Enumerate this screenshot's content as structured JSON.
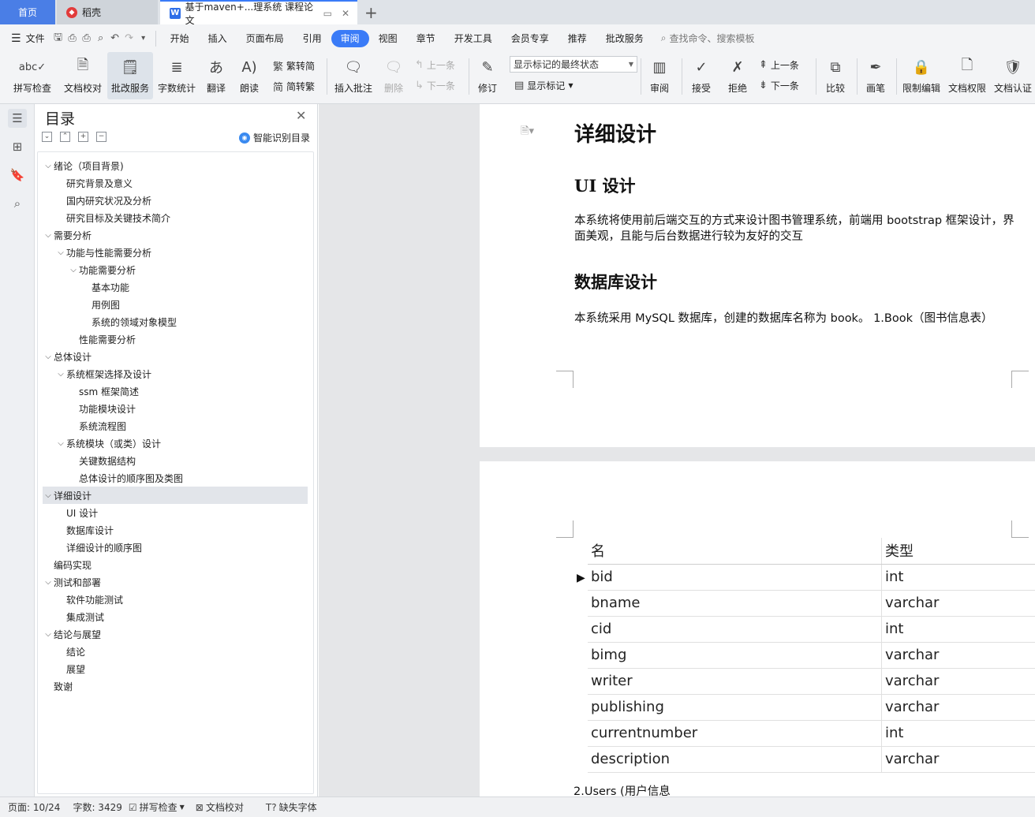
{
  "tabs": {
    "home": "首页",
    "daoke": "稻壳",
    "doc": "基于maven+...理系统 课程论文",
    "add": "+"
  },
  "menu": {
    "file": "文件",
    "items": [
      "开始",
      "插入",
      "页面布局",
      "引用",
      "审阅",
      "视图",
      "章节",
      "开发工具",
      "会员专享",
      "推荐",
      "批改服务"
    ],
    "active": "审阅",
    "search_placeholder": "查找命令、搜索模板"
  },
  "toolbar": {
    "spellcheck": "拼写检查",
    "proofread": "文档校对",
    "grading": "批改服务",
    "wordcount": "字数统计",
    "translate": "翻译",
    "read_aloud": "朗读",
    "trad": "繁转简",
    "simp": "简转繁",
    "insert_comment": "插入批注",
    "delete": "删除",
    "prev_comment": "上一条",
    "next_comment": "下一条",
    "track_changes": "修订",
    "markup_state": "显示标记的最终状态",
    "show_markup": "显示标记",
    "review": "审阅",
    "accept": "接受",
    "reject": "拒绝",
    "prev_change": "上一条",
    "next_change": "下一条",
    "compare": "比较",
    "pen": "画笔",
    "restrict_edit": "限制编辑",
    "doc_permission": "文档权限",
    "doc_cert": "文档认证"
  },
  "toc": {
    "title": "目录",
    "smart": "智能识别目录",
    "items": [
      {
        "text": "绪论（项目背景)",
        "level": 1,
        "caret": true
      },
      {
        "text": "研究背景及意义",
        "level": 2,
        "caret": false
      },
      {
        "text": "国内研究状况及分析",
        "level": 2,
        "caret": false
      },
      {
        "text": "研究目标及关键技术简介",
        "level": 2,
        "caret": false
      },
      {
        "text": "需要分析",
        "level": 1,
        "caret": true
      },
      {
        "text": "功能与性能需要分析",
        "level": 2,
        "caret": true
      },
      {
        "text": "功能需要分析",
        "level": 3,
        "caret": true
      },
      {
        "text": "基本功能",
        "level": 4,
        "caret": false
      },
      {
        "text": "用例图",
        "level": 4,
        "caret": false
      },
      {
        "text": "系统的领域对象模型",
        "level": 4,
        "caret": false
      },
      {
        "text": "性能需要分析",
        "level": 3,
        "caret": false
      },
      {
        "text": "总体设计",
        "level": 1,
        "caret": true
      },
      {
        "text": "系统框架选择及设计",
        "level": 2,
        "caret": true
      },
      {
        "text": "ssm 框架简述",
        "level": 3,
        "caret": false
      },
      {
        "text": "功能模块设计",
        "level": 3,
        "caret": false
      },
      {
        "text": "系统流程图",
        "level": 3,
        "caret": false
      },
      {
        "text": "系统模块（或类）设计",
        "level": 2,
        "caret": true
      },
      {
        "text": "关键数据结构",
        "level": 3,
        "caret": false
      },
      {
        "text": "总体设计的顺序图及类图",
        "level": 3,
        "caret": false
      },
      {
        "text": "详细设计",
        "level": 1,
        "caret": true,
        "selected": true
      },
      {
        "text": "UI 设计",
        "level": 2,
        "caret": false
      },
      {
        "text": "数据库设计",
        "level": 2,
        "caret": false
      },
      {
        "text": "详细设计的顺序图",
        "level": 2,
        "caret": false
      },
      {
        "text": "编码实现",
        "level": 1,
        "caret": false
      },
      {
        "text": "测试和部署",
        "level": 1,
        "caret": true
      },
      {
        "text": "软件功能测试",
        "level": 2,
        "caret": false
      },
      {
        "text": "集成测试",
        "level": 2,
        "caret": false
      },
      {
        "text": "结论与展望",
        "level": 1,
        "caret": true
      },
      {
        "text": "结论",
        "level": 2,
        "caret": false
      },
      {
        "text": "展望",
        "level": 2,
        "caret": false
      },
      {
        "text": "致谢",
        "level": 1,
        "caret": false
      }
    ]
  },
  "document": {
    "h_detail": "详细设计",
    "h_ui": "UI  设计",
    "p_ui": "本系统将使用前后端交互的方式来设计图书管理系统，前端用  bootstrap  框架设计，界面美观，且能与后台数据进行较为友好的交互",
    "h_db": "数据库设计",
    "p_db": "本系统采用  MySQL  数据库，创建的数据库名称为  book。 1.Book（图书信息表）",
    "table_headers": [
      "名",
      "类型"
    ],
    "table_rows": [
      [
        "bid",
        "int"
      ],
      [
        "bname",
        "varchar"
      ],
      [
        "cid",
        "int"
      ],
      [
        "bimg",
        "varchar"
      ],
      [
        "writer",
        "varchar"
      ],
      [
        "publishing",
        "varchar"
      ],
      [
        "currentnumber",
        "int"
      ],
      [
        "description",
        "varchar"
      ]
    ],
    "after_table": "2.Users (用户信息"
  },
  "status": {
    "page": "页面: 10/24",
    "words": "字数: 3429",
    "spell": "拼写检查",
    "proof": "文档校对",
    "missing_font": "缺失字体"
  }
}
